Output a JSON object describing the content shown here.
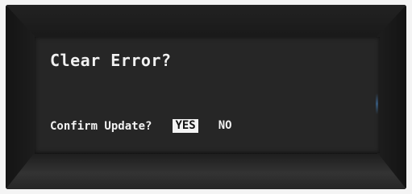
{
  "dialog": {
    "title": "Clear Error?",
    "prompt": "Confirm Update?",
    "options": [
      {
        "label": "YES",
        "selected": true
      },
      {
        "label": "NO",
        "selected": false
      }
    ]
  },
  "colors": {
    "screen_background": "#262626",
    "text": "#f2f2f2",
    "selection_highlight": "#f4f4f4",
    "bezel": "#1a1a1a"
  }
}
